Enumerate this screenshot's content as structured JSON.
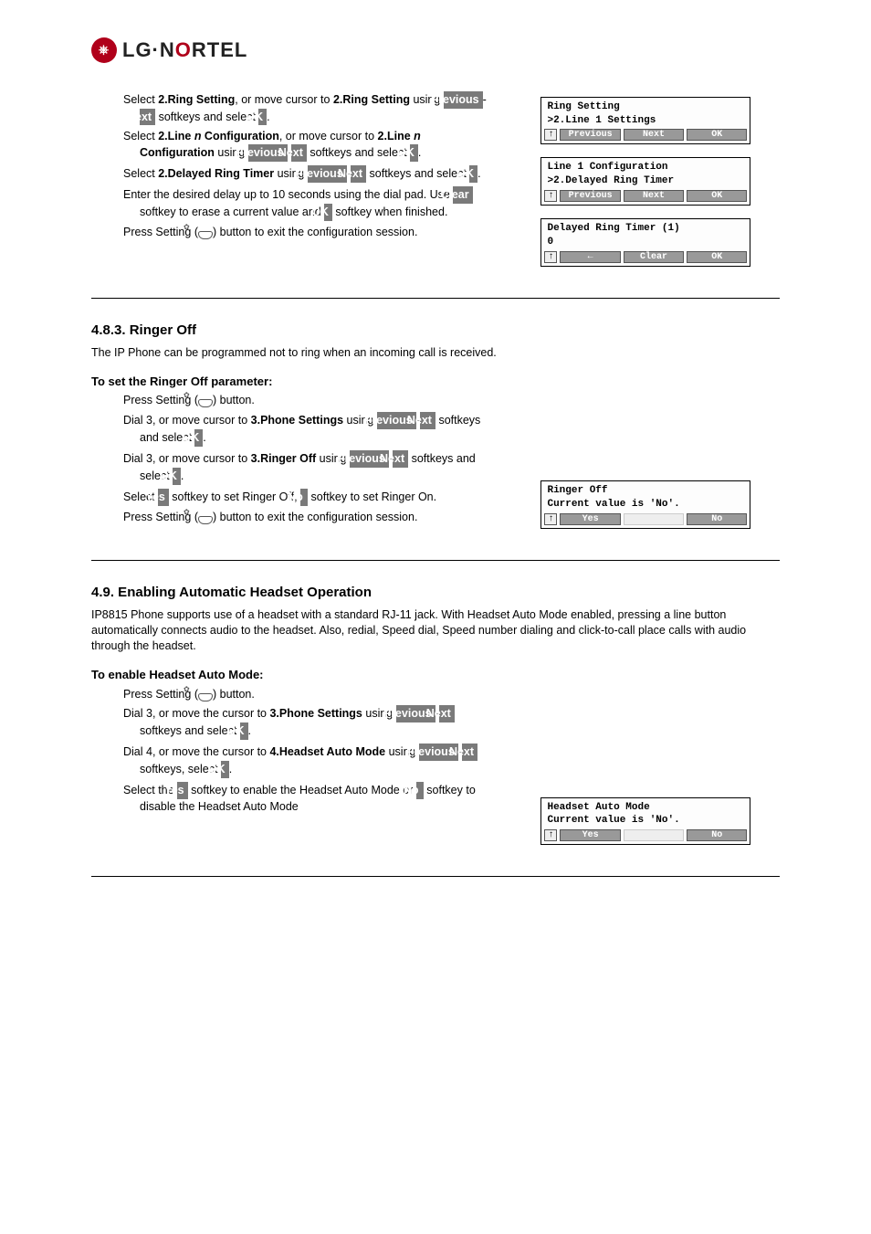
{
  "logo": "LG·NORTEL",
  "sec1": {
    "stepA": "Select ",
    "stepA_bold": "2.Ring Setting",
    "stepA_mid": ", or move cursor to ",
    "stepA_mid2": " using ",
    "stepA_end": " softkeys and select ",
    "stepB": "Select ",
    "stepB_bold": "2.Line ",
    "stepB_ital": "n",
    "stepB_bold2": " Configuration",
    "stepB_mid": ", or move cursor to ",
    "stepB_mid2": " using ",
    "stepB_end": " softkeys and select ",
    "stepC": "Select ",
    "stepC_bold": "2.Delayed Ring Timer",
    "stepC_mid": " using ",
    "stepC_end": " softkeys and select ",
    "stepD": "Enter the desired delay up to 10 seconds using the dial pad. Use ",
    "stepD_end": " softkey to erase a current value and ",
    "stepD_end2": " softkey when finished.",
    "stepE": "Press Setting (",
    "stepE_end": ") button to exit the configuration session.",
    "lcd1_l1": "Ring Setting",
    "lcd1_l2": ">2.Line 1 Settings",
    "lcd2_l1": "Line 1 Configuration",
    "lcd2_l2": ">2.Delayed Ring Timer",
    "lcd3_l1": "Delayed Ring Timer (1)",
    "lcd3_l2": "0"
  },
  "sec2": {
    "title": "4.8.3. Ringer Off",
    "para": "The IP Phone can be programmed not to ring when an incoming call is received.",
    "h3": "To set the Ringer Off parameter:",
    "stepA": "Press Setting (",
    "stepA_end": ") button.",
    "stepB": "Dial 3, or move cursor to ",
    "stepB_bold": "3.Phone Settings",
    "stepB_mid": " using ",
    "stepB_end": " softkeys and select ",
    "stepC": "Dial 3, or move cursor to ",
    "stepC_bold": "3.Ringer Off",
    "stepC_mid": " using ",
    "stepC_end": " softkeys and select ",
    "stepD_pre": "Select ",
    "stepD_mid": " softkey to set Ringer Off, ",
    "stepD_end": " softkey to set Ringer On.",
    "stepE": "Press Setting (",
    "stepE_end": ") button to exit the configuration session.",
    "lcd_l1": "Ringer Off",
    "lcd_l2": "Current value is 'No'."
  },
  "sec3": {
    "title": "4.9. Enabling Automatic Headset Operation",
    "para": "IP8815 Phone supports use of a headset with a standard RJ-11 jack. With Headset Auto Mode enabled, pressing a line button automatically connects audio to the headset. Also, redial, Speed dial, Speed number dialing and click-to-call place calls with audio through the headset.",
    "h3": "To enable Headset Auto Mode:",
    "stepA": "Press Setting (",
    "stepA_end": ") button.",
    "stepB": "Dial 3, or move the cursor to ",
    "stepB_bold": "3.Phone Settings",
    "stepB_mid": " using ",
    "stepB_end": " softkeys and select ",
    "stepC": "Dial 4, or move the cursor to ",
    "stepC_bold": "4.Headset Auto Mode",
    "stepC_mid": " using ",
    "stepC_end": " softkeys, select ",
    "stepD_pre": "Select the ",
    "stepD_mid": " softkey to enable the Headset Auto Mode or ",
    "stepD_end": " softkey to disable the Headset Auto Mode",
    "lcd_l1": "Headset Auto Mode",
    "lcd_l2": "Current value is 'No'."
  },
  "softkeys": {
    "prev": "Previous",
    "next": "Next",
    "ok": "OK",
    "clear": "Clear",
    "yes": "Yes",
    "no": "No",
    "back": "←",
    "up": "↑"
  }
}
